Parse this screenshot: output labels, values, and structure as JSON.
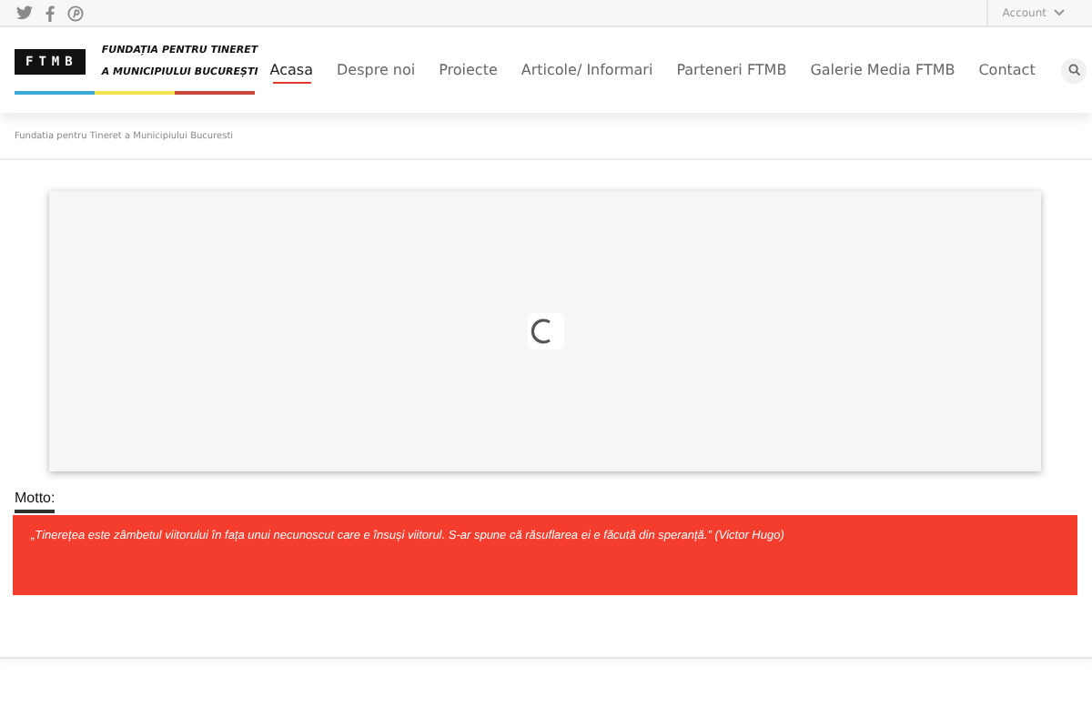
{
  "top_bar": {
    "account": "Account"
  },
  "logo": {
    "mark": "FTMB",
    "line_1": "FUNDAȚIA PENTRU TINERET",
    "line_2": "A MUNICIPIULUI BUCUREȘTI"
  },
  "nav": [
    {
      "label": "Acasa",
      "selected": true
    },
    {
      "label": "Despre noi",
      "selected": false
    },
    {
      "label": "Proiecte",
      "selected": false
    },
    {
      "label": "Articole/ Informari",
      "selected": false
    },
    {
      "label": "Parteneri FTMB",
      "selected": false
    },
    {
      "label": "Galerie Media FTMB",
      "selected": false
    },
    {
      "label": "Contact",
      "selected": false
    }
  ],
  "breadcrumb": "Fundatia pentru Tineret a Municipiului Bucuresti",
  "motto": {
    "heading": "Motto:",
    "quote": "„Tinerețea este zâmbetul viitorului în fața unui necunoscut care e însuși viitorul. S-ar spune că răsuflarea ei e făcută din speranță.” (Victor Hugo)"
  }
}
